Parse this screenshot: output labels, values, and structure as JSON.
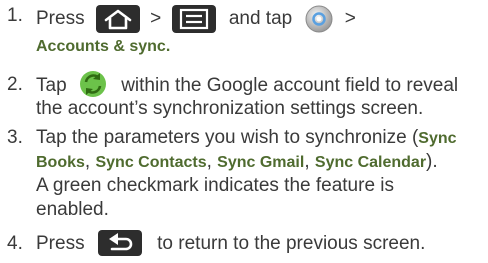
{
  "steps": [
    {
      "number": "1.",
      "press": "Press",
      "sep1": ">",
      "and_tap": "and tap",
      "sep2": ">",
      "target": "Accounts & sync.",
      "icons": [
        "home-key-icon",
        "menu-key-icon",
        "settings-gear-icon"
      ]
    },
    {
      "number": "2.",
      "tap": "Tap",
      "rest_line1": "within the Google account field to reveal",
      "line2": "the account’s synchronization settings screen.",
      "icons": [
        "sync-icon"
      ]
    },
    {
      "number": "3.",
      "line1_a": "Tap the parameters you wish to synchronize (",
      "sync_books_a": "Sync",
      "sync_books_b": "Books",
      "comma1": ", ",
      "sync_contacts": "Sync Contacts",
      "comma2": ", ",
      "sync_gmail": "Sync Gmail",
      "comma3": ", ",
      "sync_calendar": "Sync Calendar",
      "close": ").",
      "line3": "A green checkmark indicates the feature is",
      "line4": "enabled."
    },
    {
      "number": "4.",
      "press": "Press",
      "rest": "to return to the previous screen.",
      "icons": [
        "back-key-icon"
      ]
    }
  ],
  "colors": {
    "text": "#3a3a3a",
    "bold_label": "#4f6b2f",
    "key_bg": "#2d2d2d",
    "key_fg": "#ffffff",
    "sync_green": "#6cc24a"
  }
}
